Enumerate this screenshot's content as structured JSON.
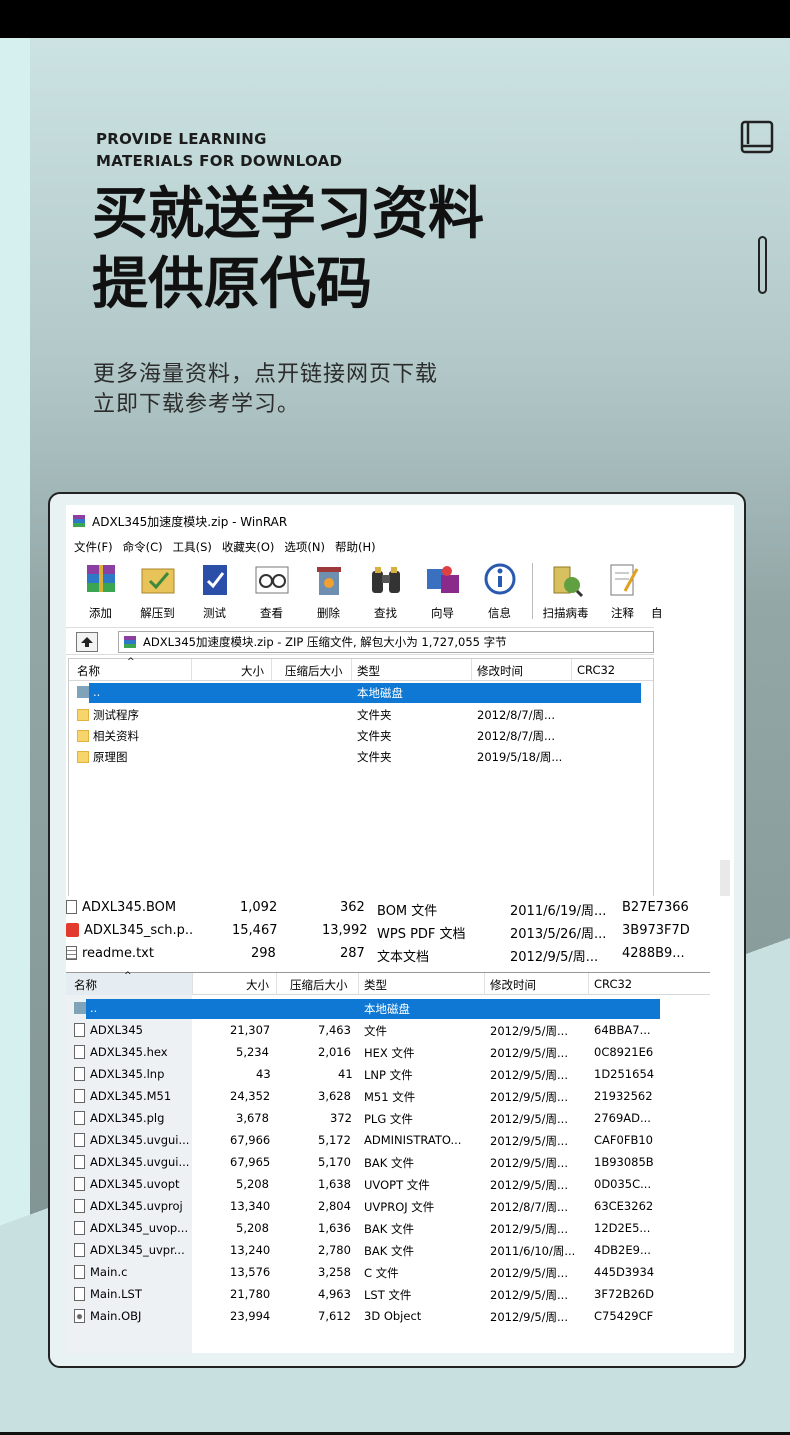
{
  "hero": {
    "en_line1": "PROVIDE LEARNING",
    "en_line2": "MATERIALS FOR DOWNLOAD",
    "cn_title_line1": "买就送学习资料",
    "cn_title_line2": "提供原代码",
    "cn_sub_line1": "更多海量资料，点开链接网页下载",
    "cn_sub_line2": "立即下载参考学习。"
  },
  "icons": {
    "book": "book-icon",
    "scroll": "scroll-indicator-icon"
  },
  "window": {
    "title": "ADXL345加速度模块.zip - WinRAR",
    "menu": [
      "文件(F)",
      "命令(C)",
      "工具(S)",
      "收藏夹(O)",
      "选项(N)",
      "帮助(H)"
    ],
    "toolbar": [
      "添加",
      "解压到",
      "测试",
      "查看",
      "删除",
      "查找",
      "向导",
      "信息",
      "扫描病毒",
      "注释",
      "自"
    ],
    "address": "ADXL345加速度模块.zip - ZIP 压缩文件, 解包大小为 1,727,055 字节"
  },
  "columns": [
    "名称",
    "大小",
    "压缩后大小",
    "类型",
    "修改时间",
    "CRC32"
  ],
  "pane1": [
    {
      "name": "..",
      "size": "",
      "packed": "",
      "type": "本地磁盘",
      "time": "",
      "crc": "",
      "icon": "drive"
    },
    {
      "name": "测试程序",
      "size": "",
      "packed": "",
      "type": "文件夹",
      "time": "2012/8/7/周...",
      "crc": "",
      "icon": "folder"
    },
    {
      "name": "相关资料",
      "size": "",
      "packed": "",
      "type": "文件夹",
      "time": "2012/8/7/周...",
      "crc": "",
      "icon": "folder"
    },
    {
      "name": "原理图",
      "size": "",
      "packed": "",
      "type": "文件夹",
      "time": "2019/5/18/周...",
      "crc": "",
      "icon": "folder"
    }
  ],
  "pane2": [
    {
      "name": "ADXL345.BOM",
      "size": "1,092",
      "packed": "362",
      "type": "BOM 文件",
      "time": "2011/6/19/周...",
      "crc": "B27E7366",
      "icon": "file"
    },
    {
      "name": "ADXL345_sch.p...",
      "size": "15,467",
      "packed": "13,992",
      "type": "WPS PDF 文档",
      "time": "2013/5/26/周...",
      "crc": "3B973F7D",
      "icon": "pdf"
    },
    {
      "name": "readme.txt",
      "size": "298",
      "packed": "287",
      "type": "文本文档",
      "time": "2012/9/5/周...",
      "crc": "4288B9...",
      "icon": "txt"
    }
  ],
  "pane3": [
    {
      "name": "..",
      "size": "",
      "packed": "",
      "type": "本地磁盘",
      "time": "",
      "crc": "",
      "icon": "drive"
    },
    {
      "name": "ADXL345",
      "size": "21,307",
      "packed": "7,463",
      "type": "文件",
      "time": "2012/9/5/周...",
      "crc": "64BBA7...",
      "icon": "file"
    },
    {
      "name": "ADXL345.hex",
      "size": "5,234",
      "packed": "2,016",
      "type": "HEX 文件",
      "time": "2012/9/5/周...",
      "crc": "0C8921E6",
      "icon": "file"
    },
    {
      "name": "ADXL345.lnp",
      "size": "43",
      "packed": "41",
      "type": "LNP 文件",
      "time": "2012/9/5/周...",
      "crc": "1D251654",
      "icon": "file"
    },
    {
      "name": "ADXL345.M51",
      "size": "24,352",
      "packed": "3,628",
      "type": "M51 文件",
      "time": "2012/9/5/周...",
      "crc": "21932562",
      "icon": "file"
    },
    {
      "name": "ADXL345.plg",
      "size": "3,678",
      "packed": "372",
      "type": "PLG 文件",
      "time": "2012/9/5/周...",
      "crc": "2769AD...",
      "icon": "file"
    },
    {
      "name": "ADXL345.uvgui...",
      "size": "67,966",
      "packed": "5,172",
      "type": "ADMINISTRATO...",
      "time": "2012/9/5/周...",
      "crc": "CAF0FB10",
      "icon": "file"
    },
    {
      "name": "ADXL345.uvgui...",
      "size": "67,965",
      "packed": "5,170",
      "type": "BAK 文件",
      "time": "2012/9/5/周...",
      "crc": "1B93085B",
      "icon": "file"
    },
    {
      "name": "ADXL345.uvopt",
      "size": "5,208",
      "packed": "1,638",
      "type": "UVOPT 文件",
      "time": "2012/9/5/周...",
      "crc": "0D035C...",
      "icon": "file"
    },
    {
      "name": "ADXL345.uvproj",
      "size": "13,340",
      "packed": "2,804",
      "type": "UVPROJ 文件",
      "time": "2012/8/7/周...",
      "crc": "63CE3262",
      "icon": "file"
    },
    {
      "name": "ADXL345_uvop...",
      "size": "5,208",
      "packed": "1,636",
      "type": "BAK 文件",
      "time": "2012/9/5/周...",
      "crc": "12D2E5...",
      "icon": "file"
    },
    {
      "name": "ADXL345_uvpr...",
      "size": "13,240",
      "packed": "2,780",
      "type": "BAK 文件",
      "time": "2011/6/10/周...",
      "crc": "4DB2E9...",
      "icon": "file"
    },
    {
      "name": "Main.c",
      "size": "13,576",
      "packed": "3,258",
      "type": "C 文件",
      "time": "2012/9/5/周...",
      "crc": "445D3934",
      "icon": "file"
    },
    {
      "name": "Main.LST",
      "size": "21,780",
      "packed": "4,963",
      "type": "LST 文件",
      "time": "2012/9/5/周...",
      "crc": "3F72B26D",
      "icon": "file"
    },
    {
      "name": "Main.OBJ",
      "size": "23,994",
      "packed": "7,612",
      "type": "3D Object",
      "time": "2012/9/5/周...",
      "crc": "C75429CF",
      "icon": "obj"
    }
  ]
}
